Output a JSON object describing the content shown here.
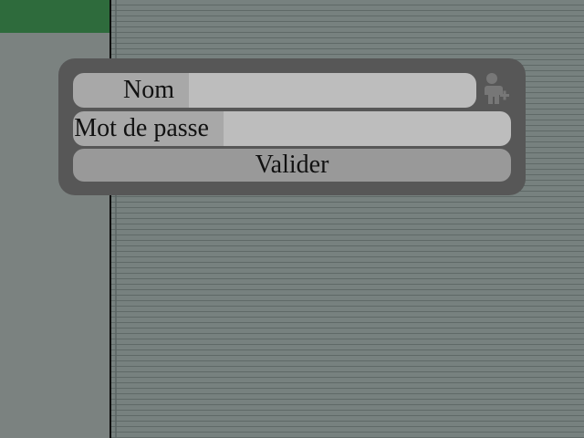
{
  "colors": {
    "accent_green": "#2e6b3c",
    "dialog_bg": "#575757",
    "label_bg": "#a8a8a8",
    "field_bg": "#bdbdbd",
    "button_bg": "#999999"
  },
  "login": {
    "username_label": "Nom",
    "username_value": "",
    "password_label": "Mot de passe",
    "password_value": "",
    "submit_label": "Valider",
    "add_user_icon": "user-add-icon"
  }
}
